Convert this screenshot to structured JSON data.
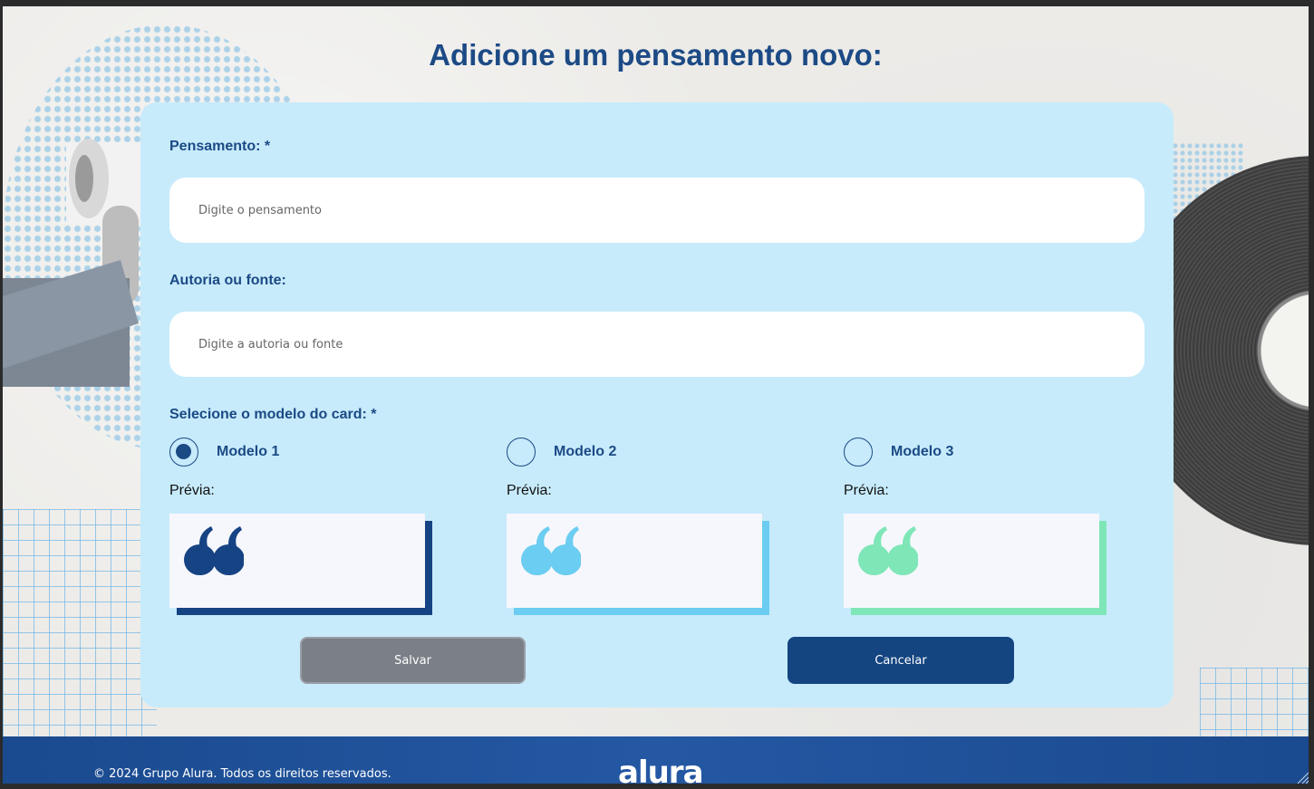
{
  "page": {
    "title": "Adicione um pensamento novo:"
  },
  "form": {
    "thought_label": "Pensamento: *",
    "thought_placeholder": "Digite o pensamento",
    "author_label": "Autoria ou fonte:",
    "author_placeholder": "Digite a autoria ou fonte",
    "model_label": "Selecione o modelo do card: *",
    "models": [
      {
        "label": "Modelo 1",
        "preview_label": "Prévia:",
        "checked": true,
        "color": "#164383"
      },
      {
        "label": "Modelo 2",
        "preview_label": "Prévia:",
        "checked": false,
        "color": "#6bcdf1"
      },
      {
        "label": "Modelo 3",
        "preview_label": "Prévia:",
        "checked": false,
        "color": "#7fe6b8"
      }
    ],
    "save_label": "Salvar",
    "cancel_label": "Cancelar"
  },
  "footer": {
    "copyright": "© 2024 Grupo Alura. Todos os direitos reservados.",
    "logo": "alura"
  },
  "colors": {
    "primary": "#1c4a85",
    "card_background": "#c7ebfb",
    "save_button": "#7b7f87",
    "cancel_button": "#144581"
  }
}
